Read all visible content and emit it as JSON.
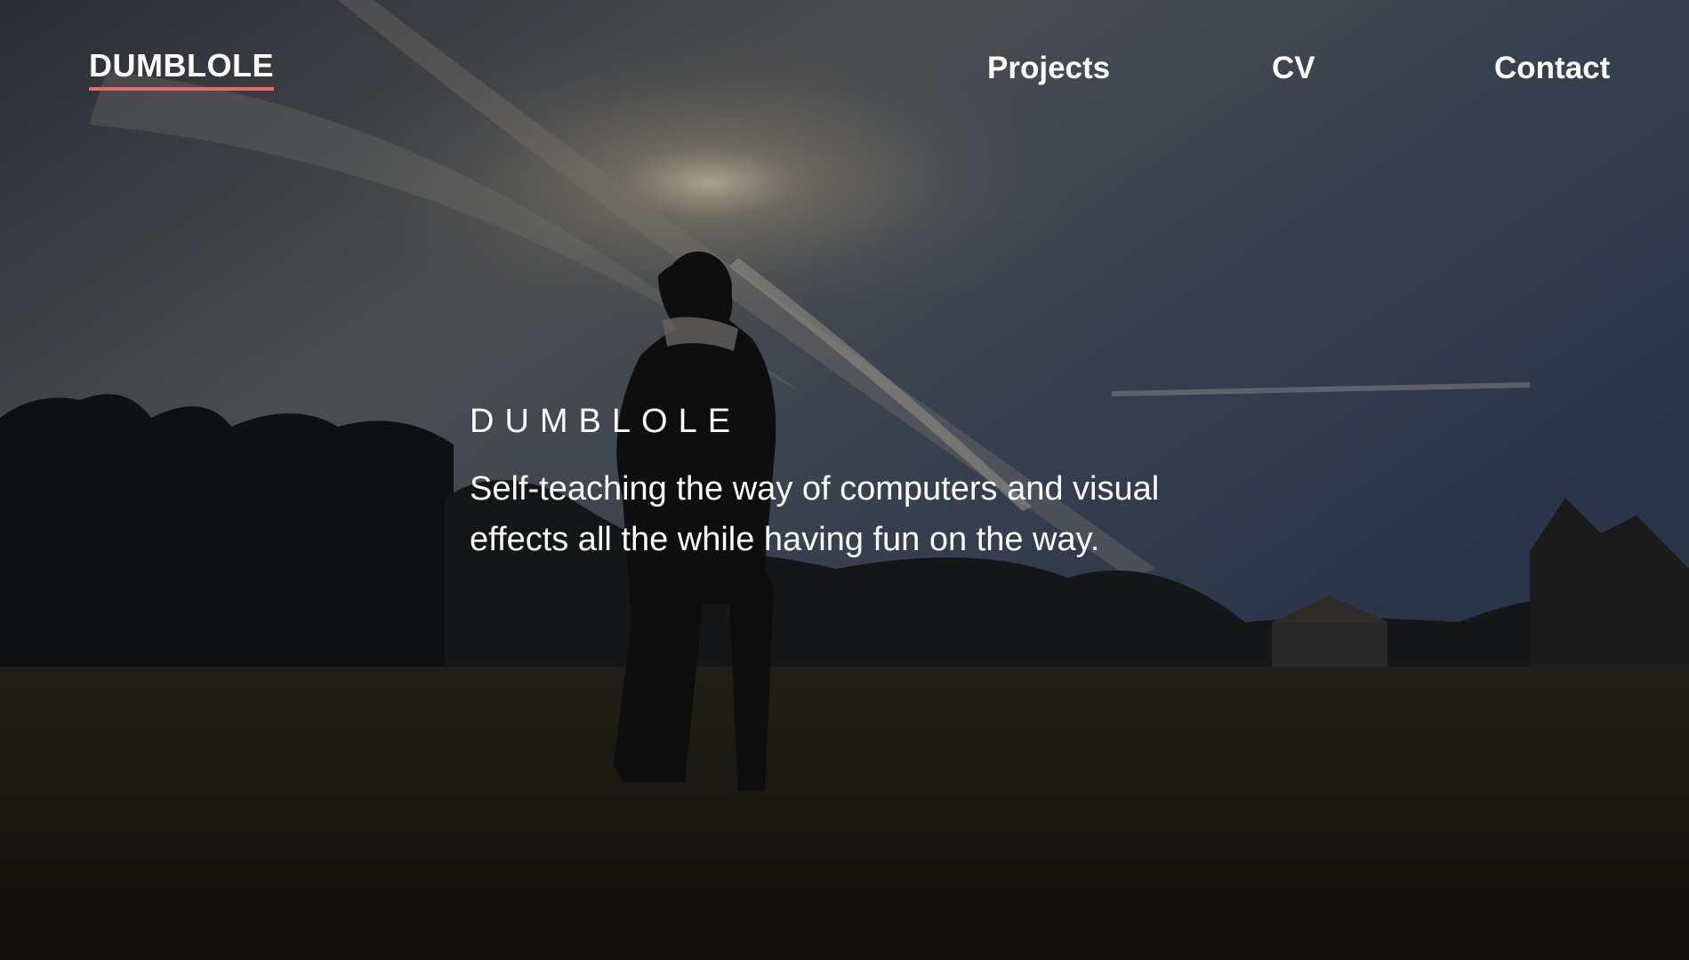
{
  "nav": {
    "logo": "DUMBLOLE",
    "links": [
      "Projects",
      "CV",
      "Contact"
    ]
  },
  "hero": {
    "title": "DUMBLOLE",
    "subtitle": "Self-teaching the way of computers and visual effects all the while having fun on the way."
  },
  "colors": {
    "accent": "#e8686e",
    "text": "#ffffff"
  }
}
